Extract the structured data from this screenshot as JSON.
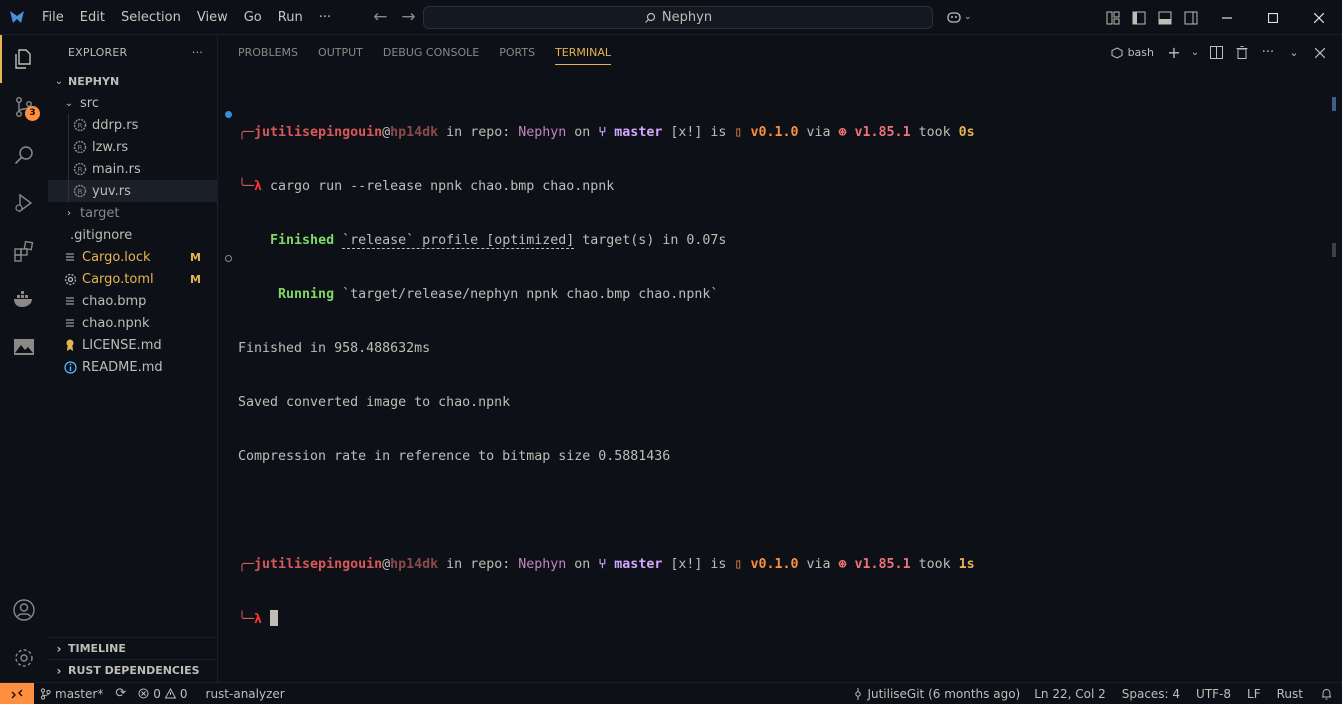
{
  "menu": [
    "File",
    "Edit",
    "Selection",
    "View",
    "Go",
    "Run",
    "···"
  ],
  "search": {
    "text": "Nephyn"
  },
  "explorer": {
    "title": "EXPLORER",
    "more": "···",
    "root": "NEPHYN",
    "src": "src",
    "files_src": [
      {
        "name": "ddrp.rs"
      },
      {
        "name": "lzw.rs"
      },
      {
        "name": "main.rs"
      },
      {
        "name": "yuv.rs"
      }
    ],
    "target": "target",
    "gitignore": ".gitignore",
    "cargo_lock": "Cargo.lock",
    "cargo_toml": "Cargo.toml",
    "modified_flag": "M",
    "chao_bmp": "chao.bmp",
    "chao_npnk": "chao.npnk",
    "license": "LICENSE.md",
    "readme": "README.md",
    "timeline": "TIMELINE",
    "rust_deps": "RUST DEPENDENCIES"
  },
  "scm_badge": "3",
  "panel": {
    "tabs": [
      "PROBLEMS",
      "OUTPUT",
      "DEBUG CONSOLE",
      "PORTS",
      "TERMINAL"
    ],
    "terminal_name": "bash"
  },
  "terminal": {
    "user": "jutilisepingouin",
    "at": "@",
    "host": "hp14dk",
    "in_repo": " in repo: ",
    "repo": "Nephyn",
    "on": " on ",
    "branch_glyph": "⑂ ",
    "branch": "master",
    "status": " [x!] ",
    "is": "is ",
    "pkg_glyph": "▯ ",
    "version": "v0.1.0",
    "via": " via ",
    "rust_glyph": "⊛ ",
    "rust_version": "v1.85.1",
    "took": " took ",
    "took1": "0s",
    "took2": "1s",
    "lambda": "λ",
    "command": " cargo run --release npnk chao.bmp chao.npnk",
    "finished_kw": "Finished",
    "finished_rest_a": " ",
    "finished_profile": "`release` profile [optimized]",
    "finished_rest_b": " target(s) in 0.07s",
    "running_kw": "Running",
    "running_rest": " `target/release/nephyn npnk chao.bmp chao.npnk`",
    "out1": "Finished in 958.488632ms",
    "out2": "Saved converted image to chao.npnk",
    "out3": "Compression rate in reference to bitmap size 0.5881436"
  },
  "status": {
    "branch": "master*",
    "errors": "0",
    "warnings": "0",
    "analyzer": "rust-analyzer",
    "blame": "JutiliseGit (6 months ago)",
    "position": "Ln 22, Col 2",
    "spaces": "Spaces: 4",
    "encoding": "UTF-8",
    "eol": "LF",
    "language": "Rust"
  },
  "colors": {
    "accent": "#e6b450",
    "badge": "#ff8f40",
    "background": "#0d1017"
  }
}
